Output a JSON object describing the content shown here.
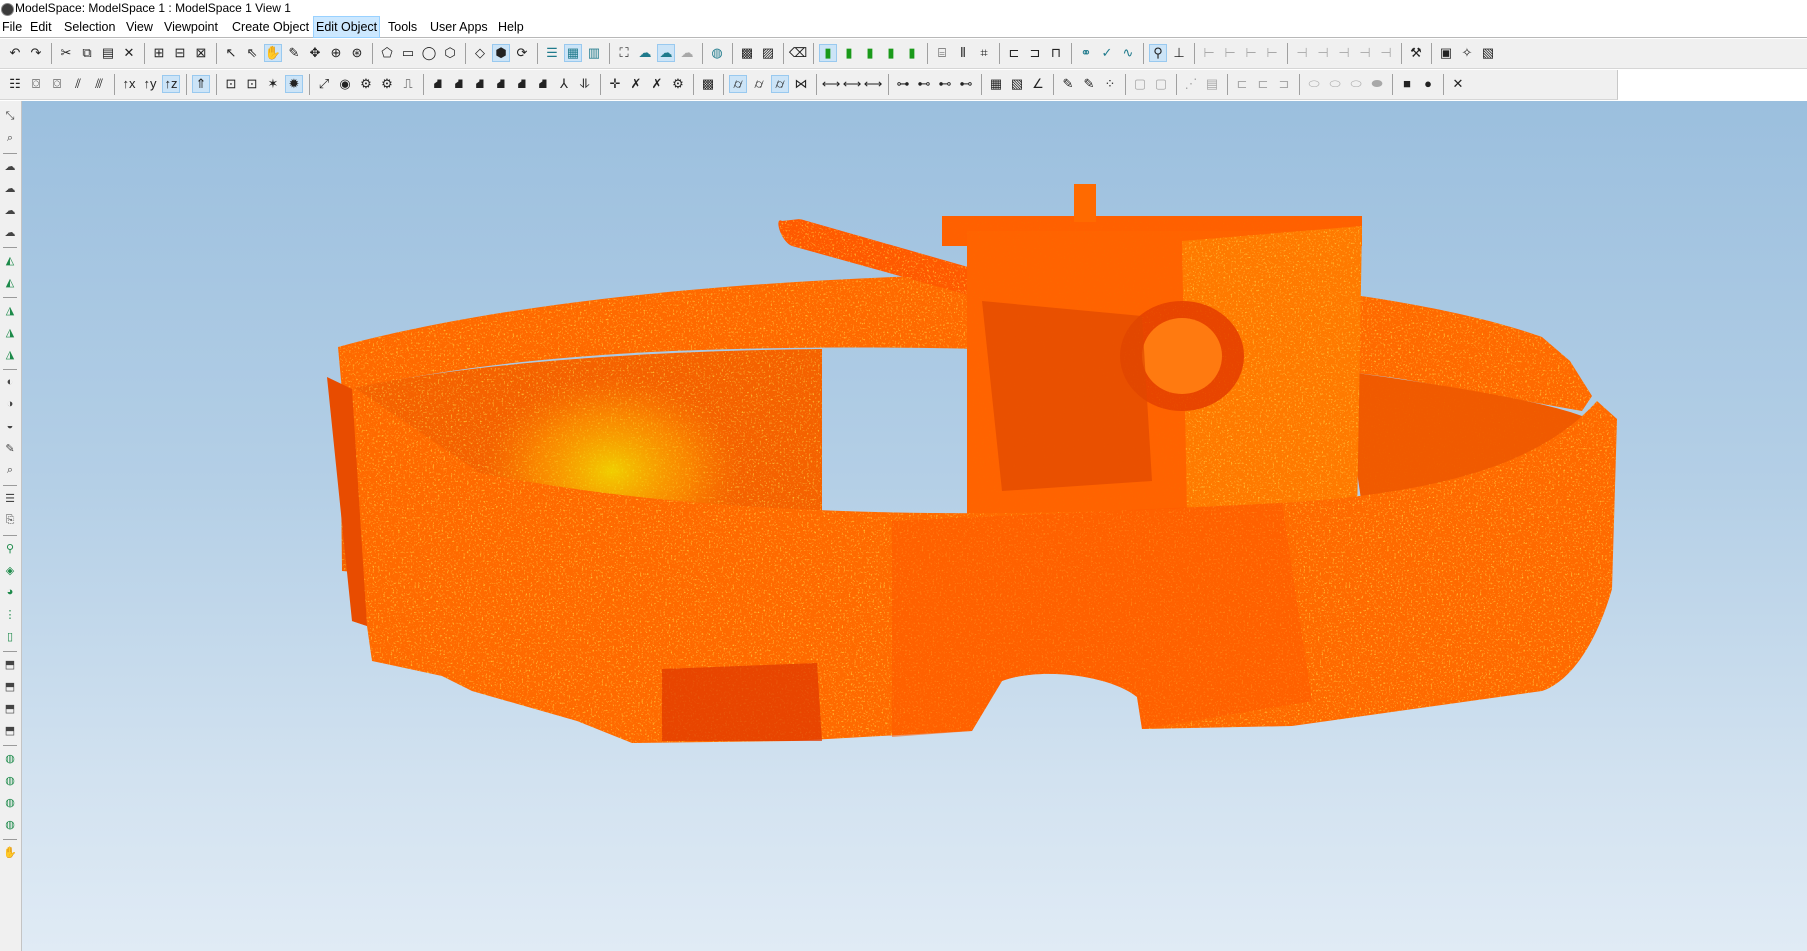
{
  "window": {
    "title": "ModelSpace: ModelSpace 1 : ModelSpace 1 View 1"
  },
  "menu": [
    {
      "label": "File",
      "active": false
    },
    {
      "label": "Edit",
      "active": false
    },
    {
      "label": "Selection",
      "active": false
    },
    {
      "label": "View",
      "active": false
    },
    {
      "label": "Viewpoint",
      "active": false
    },
    {
      "label": "Create Object",
      "active": false
    },
    {
      "label": "Edit Object",
      "active": true
    },
    {
      "label": "Tools",
      "active": false
    },
    {
      "label": "User Apps",
      "active": false
    },
    {
      "label": "Help",
      "active": false
    }
  ],
  "toolbar1": [
    {
      "icon": "undo-icon",
      "glyph": "↶"
    },
    {
      "icon": "redo-icon",
      "glyph": "↷"
    },
    {
      "sep": true
    },
    {
      "icon": "cut-icon",
      "glyph": "✂"
    },
    {
      "icon": "copy-icon",
      "glyph": "⧉"
    },
    {
      "icon": "paste-icon",
      "glyph": "▤"
    },
    {
      "icon": "delete-icon",
      "glyph": "✕"
    },
    {
      "sep": true
    },
    {
      "icon": "group-icon",
      "glyph": "⊞"
    },
    {
      "icon": "ungroup-icon",
      "glyph": "⊟"
    },
    {
      "icon": "layout-icon",
      "glyph": "⊠"
    },
    {
      "sep": true
    },
    {
      "icon": "select-arrow-icon",
      "glyph": "↖"
    },
    {
      "icon": "select-plus-icon",
      "glyph": "⇖"
    },
    {
      "icon": "pan-hand-icon",
      "glyph": "✋",
      "pressed": true
    },
    {
      "icon": "pencil-icon",
      "glyph": "✎"
    },
    {
      "icon": "move-icon",
      "glyph": "✥"
    },
    {
      "icon": "orbit-icon",
      "glyph": "⊕"
    },
    {
      "icon": "target-icon",
      "glyph": "⊛"
    },
    {
      "sep": true
    },
    {
      "icon": "lasso-icon",
      "glyph": "⬠"
    },
    {
      "icon": "rectangle-select-icon",
      "glyph": "▭"
    },
    {
      "icon": "circle-select-icon",
      "glyph": "◯"
    },
    {
      "icon": "polygon-fence-icon",
      "glyph": "⬡"
    },
    {
      "sep": true
    },
    {
      "icon": "plane-icon",
      "glyph": "◇"
    },
    {
      "icon": "box-icon",
      "glyph": "⬢",
      "pressed": true
    },
    {
      "icon": "rotate-icon",
      "glyph": "⟳"
    },
    {
      "sep": true
    },
    {
      "icon": "layers-green-icon",
      "glyph": "☰"
    },
    {
      "icon": "points-color-icon",
      "glyph": "▦",
      "pressed": true
    },
    {
      "icon": "points-split-icon",
      "glyph": "▥"
    },
    {
      "sep": true
    },
    {
      "icon": "fence-icon",
      "glyph": "⛶"
    },
    {
      "icon": "cloud-icon",
      "glyph": "☁"
    },
    {
      "icon": "cloud-active-icon",
      "glyph": "☁",
      "pressed": true
    },
    {
      "icon": "cloud-gray-icon",
      "glyph": "☁"
    },
    {
      "sep": true
    },
    {
      "icon": "sphere-icon",
      "glyph": "◍"
    },
    {
      "sep": true
    },
    {
      "icon": "grid-icon",
      "glyph": "▩"
    },
    {
      "icon": "grid-dots-icon",
      "glyph": "▨"
    },
    {
      "sep": true
    },
    {
      "icon": "eraser-icon",
      "glyph": "⌫"
    },
    {
      "sep": true
    },
    {
      "icon": "green-bar-1-icon",
      "glyph": "▮",
      "pressed": true
    },
    {
      "icon": "green-bar-2-icon",
      "glyph": "▮"
    },
    {
      "icon": "green-bar-3-icon",
      "glyph": "▮"
    },
    {
      "icon": "green-bar-4-icon",
      "glyph": "▮"
    },
    {
      "icon": "green-bar-5-icon",
      "glyph": "▮"
    },
    {
      "sep": true
    },
    {
      "icon": "cylinder-icon",
      "glyph": "⌸"
    },
    {
      "icon": "columns-icon",
      "glyph": "⫴"
    },
    {
      "icon": "scan-icon",
      "glyph": "⌗"
    },
    {
      "sep": true
    },
    {
      "icon": "pipe-icon",
      "glyph": "⊏"
    },
    {
      "icon": "pipe-2-icon",
      "glyph": "⊐"
    },
    {
      "icon": "pipe-3-icon",
      "glyph": "⊓"
    },
    {
      "sep": true
    },
    {
      "icon": "link-icon",
      "glyph": "⚭"
    },
    {
      "icon": "check-icon",
      "glyph": "✓"
    },
    {
      "icon": "curve-icon",
      "glyph": "∿"
    },
    {
      "sep": true
    },
    {
      "icon": "user-select-icon",
      "glyph": "⚲",
      "pressed": true
    },
    {
      "icon": "axis-icon",
      "glyph": "⊥"
    },
    {
      "sep": true
    },
    {
      "icon": "dim-1-icon",
      "glyph": "⊢"
    },
    {
      "icon": "dim-2-icon",
      "glyph": "⊢"
    },
    {
      "icon": "dim-3-icon",
      "glyph": "⊢"
    },
    {
      "icon": "dim-4-icon",
      "glyph": "⊢"
    },
    {
      "sep": true
    },
    {
      "icon": "dim-5-icon",
      "glyph": "⊣"
    },
    {
      "icon": "dim-6-icon",
      "glyph": "⊣"
    },
    {
      "icon": "dim-7-icon",
      "glyph": "⊣"
    },
    {
      "icon": "dim-8-icon",
      "glyph": "⊣"
    },
    {
      "icon": "dim-9-icon",
      "glyph": "⊣"
    },
    {
      "sep": true
    },
    {
      "icon": "tool-a-icon",
      "glyph": "⚒"
    },
    {
      "sep": true
    },
    {
      "icon": "tool-b-icon",
      "glyph": "▣"
    },
    {
      "icon": "tool-c-icon",
      "glyph": "✧"
    },
    {
      "icon": "tool-d-icon",
      "glyph": "▧"
    }
  ],
  "toolbar2": [
    {
      "icon": "layer-stack-icon",
      "glyph": "☷"
    },
    {
      "icon": "camera-icon",
      "glyph": "⌼"
    },
    {
      "icon": "camera-2-icon",
      "glyph": "⌼"
    },
    {
      "icon": "measure-icon",
      "glyph": "⫽"
    },
    {
      "icon": "measure-2-icon",
      "glyph": "⫻"
    },
    {
      "sep": true
    },
    {
      "icon": "axis-x-icon",
      "glyph": "↑x"
    },
    {
      "icon": "axis-y-icon",
      "glyph": "↑y"
    },
    {
      "icon": "axis-z-icon",
      "glyph": "↑z",
      "pressed": true
    },
    {
      "sep": true
    },
    {
      "icon": "up-arrow-icon",
      "glyph": "⇑",
      "pressed": true
    },
    {
      "sep": true
    },
    {
      "icon": "view-1-icon",
      "glyph": "⊡"
    },
    {
      "icon": "view-2-icon",
      "glyph": "⊡"
    },
    {
      "icon": "view-3-icon",
      "glyph": "✶"
    },
    {
      "icon": "highlight-icon",
      "glyph": "✹",
      "pressed": true
    },
    {
      "sep": true
    },
    {
      "icon": "snap-1-icon",
      "glyph": "⤢"
    },
    {
      "icon": "snap-2-icon",
      "glyph": "◉"
    },
    {
      "icon": "snap-3-icon",
      "glyph": "⚙"
    },
    {
      "icon": "snap-4-icon",
      "glyph": "⚙"
    },
    {
      "icon": "snap-5-icon",
      "glyph": "⎍"
    },
    {
      "sep": true
    },
    {
      "icon": "shape-1-icon",
      "glyph": "⛘"
    },
    {
      "icon": "shape-2-icon",
      "glyph": "⛘"
    },
    {
      "icon": "shape-3-icon",
      "glyph": "⛘"
    },
    {
      "icon": "shape-4-icon",
      "glyph": "⛘"
    },
    {
      "icon": "shape-5-icon",
      "glyph": "⛘"
    },
    {
      "icon": "shape-6-icon",
      "glyph": "⛘"
    },
    {
      "icon": "shape-7-icon",
      "glyph": "⅄"
    },
    {
      "icon": "shape-8-icon",
      "glyph": "⥥"
    },
    {
      "sep": true
    },
    {
      "icon": "constraint-1-icon",
      "glyph": "✛"
    },
    {
      "icon": "constraint-2-icon",
      "glyph": "✗"
    },
    {
      "icon": "constraint-3-icon",
      "glyph": "✗"
    },
    {
      "icon": "constraint-4-icon",
      "glyph": "⚙"
    },
    {
      "sep": true
    },
    {
      "icon": "texture-icon",
      "glyph": "▩"
    },
    {
      "sep": true
    },
    {
      "icon": "cylinder-fit-icon",
      "glyph": "⌭",
      "pressed": true
    },
    {
      "icon": "cylinder-fit-2-icon",
      "glyph": "⌭"
    },
    {
      "icon": "cylinder-fit-3-icon",
      "glyph": "⌭",
      "pressed": true
    },
    {
      "icon": "fit-pipe-icon",
      "glyph": "⋈"
    },
    {
      "sep": true
    },
    {
      "icon": "align-1-icon",
      "glyph": "⟷"
    },
    {
      "icon": "align-2-icon",
      "glyph": "⟷"
    },
    {
      "icon": "align-3-icon",
      "glyph": "⟷"
    },
    {
      "sep": true
    },
    {
      "icon": "node-1-icon",
      "glyph": "⊶"
    },
    {
      "icon": "node-2-icon",
      "glyph": "⊷"
    },
    {
      "icon": "node-3-icon",
      "glyph": "⊷"
    },
    {
      "icon": "node-4-icon",
      "glyph": "⊷"
    },
    {
      "sep": true
    },
    {
      "icon": "hatch-icon",
      "glyph": "▦"
    },
    {
      "icon": "hatch-2-icon",
      "glyph": "▧"
    },
    {
      "icon": "angle-icon",
      "glyph": "∠"
    },
    {
      "sep": true
    },
    {
      "icon": "paint-1-icon",
      "glyph": "✎"
    },
    {
      "icon": "paint-2-icon",
      "glyph": "✎"
    },
    {
      "icon": "palette-icon",
      "glyph": "⁘"
    },
    {
      "sep": true
    },
    {
      "icon": "gray-1-icon",
      "glyph": "▢"
    },
    {
      "icon": "gray-2-icon",
      "glyph": "▢"
    },
    {
      "sep": true
    },
    {
      "icon": "gray-3-icon",
      "glyph": "⋰"
    },
    {
      "icon": "gray-4-icon",
      "glyph": "▤"
    },
    {
      "sep": true
    },
    {
      "icon": "gray-5-icon",
      "glyph": "⊏"
    },
    {
      "icon": "gray-6-icon",
      "glyph": "⊏"
    },
    {
      "icon": "gray-7-icon",
      "glyph": "⊐"
    },
    {
      "sep": true
    },
    {
      "icon": "gray-8-icon",
      "glyph": "⬭"
    },
    {
      "icon": "gray-9-icon",
      "glyph": "⬭"
    },
    {
      "icon": "gray-10-icon",
      "glyph": "⬭"
    },
    {
      "icon": "gray-11-icon",
      "glyph": "⬬"
    },
    {
      "sep": true
    },
    {
      "icon": "square-solid-icon",
      "glyph": "■"
    },
    {
      "icon": "circle-solid-icon",
      "glyph": "●"
    },
    {
      "sep": true
    },
    {
      "icon": "close-view-icon",
      "glyph": "✕"
    }
  ],
  "lefttoolbar": [
    {
      "icon": "pick-1-icon",
      "glyph": "⤡"
    },
    {
      "icon": "pick-2-icon",
      "glyph": "⌕"
    },
    {
      "sep": true
    },
    {
      "icon": "cloud-tool-1-icon",
      "glyph": "☁"
    },
    {
      "icon": "cloud-tool-2-icon",
      "glyph": "☁"
    },
    {
      "icon": "cloud-tool-3-icon",
      "glyph": "☁"
    },
    {
      "icon": "cloud-tool-4-icon",
      "glyph": "☁"
    },
    {
      "sep": true
    },
    {
      "icon": "mesh-1-icon",
      "glyph": "◭"
    },
    {
      "icon": "mesh-2-icon",
      "glyph": "◭"
    },
    {
      "sep": true
    },
    {
      "icon": "mesh-3-icon",
      "glyph": "◮"
    },
    {
      "icon": "mesh-4-icon",
      "glyph": "◮"
    },
    {
      "icon": "mesh-5-icon",
      "glyph": "◮"
    },
    {
      "sep": true
    },
    {
      "icon": "shape-a-icon",
      "glyph": "◐"
    },
    {
      "icon": "shape-b-icon",
      "glyph": "◑"
    },
    {
      "icon": "shape-c-icon",
      "glyph": "◒"
    },
    {
      "icon": "shape-d-icon",
      "glyph": "✎"
    },
    {
      "icon": "shape-e-icon",
      "glyph": "⌕"
    },
    {
      "sep": true
    },
    {
      "icon": "stack-1-icon",
      "glyph": "☰"
    },
    {
      "icon": "stack-2-icon",
      "glyph": "⎘"
    },
    {
      "sep": true
    },
    {
      "icon": "globe-1-icon",
      "glyph": "⚲"
    },
    {
      "icon": "globe-2-icon",
      "glyph": "◈"
    },
    {
      "icon": "globe-3-icon",
      "glyph": "◕"
    },
    {
      "icon": "globe-4-icon",
      "glyph": "⋮"
    },
    {
      "icon": "globe-5-icon",
      "glyph": "▯"
    },
    {
      "sep": true
    },
    {
      "icon": "box-tool-1-icon",
      "glyph": "⬒"
    },
    {
      "icon": "box-tool-2-icon",
      "glyph": "⬒"
    },
    {
      "icon": "box-tool-3-icon",
      "glyph": "⬒"
    },
    {
      "icon": "box-tool-4-icon",
      "glyph": "⬒"
    },
    {
      "sep": true
    },
    {
      "icon": "teal-1-icon",
      "glyph": "◍"
    },
    {
      "icon": "teal-2-icon",
      "glyph": "◍"
    },
    {
      "icon": "teal-3-icon",
      "glyph": "◍"
    },
    {
      "icon": "teal-4-icon",
      "glyph": "◍"
    },
    {
      "sep": true
    },
    {
      "icon": "hand-tool-icon",
      "glyph": "✋"
    }
  ],
  "viewport": {
    "background_top": "#9bbfde",
    "background_bottom": "#e0ebf5",
    "pointcloud_colors": {
      "base": "#ff6a00",
      "dark": "#e63900",
      "highlight": "#ffb000",
      "yellow": "#f5e400",
      "green": "#b8f000"
    }
  }
}
